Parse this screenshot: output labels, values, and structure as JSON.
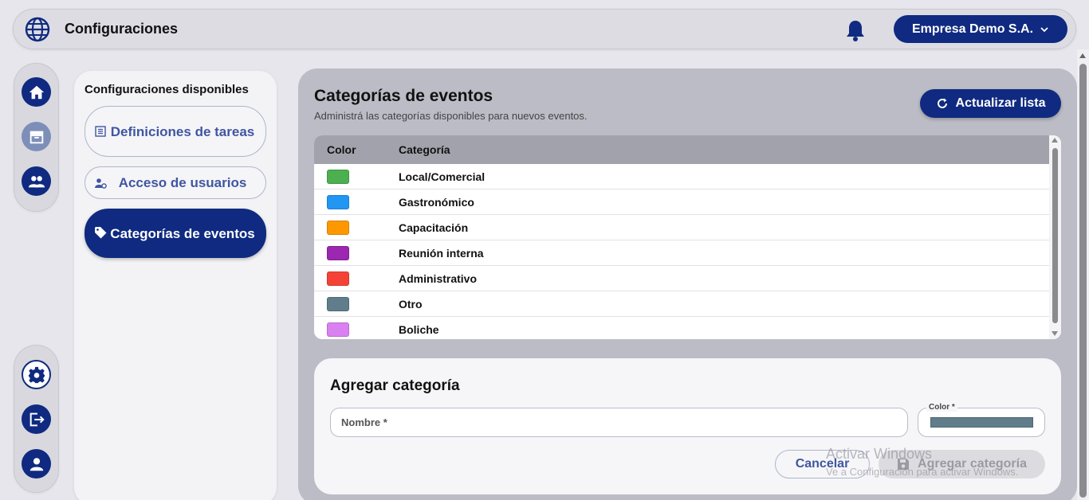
{
  "header": {
    "title": "Configuraciones",
    "company": "Empresa Demo S.A."
  },
  "rail": {
    "top": [
      {
        "icon": "home-icon"
      },
      {
        "icon": "archive-icon"
      },
      {
        "icon": "users-icon"
      }
    ],
    "bottom": [
      {
        "icon": "gear-icon"
      },
      {
        "icon": "logout-icon"
      },
      {
        "icon": "account-icon"
      }
    ]
  },
  "sidebar": {
    "title": "Configuraciones disponibles",
    "items": [
      {
        "label": "Definiciones de tareas",
        "icon": "list-icon",
        "active": false
      },
      {
        "label": "Acceso de usuarios",
        "icon": "user-gear-icon",
        "active": false
      },
      {
        "label": "Categorías de eventos",
        "icon": "tag-icon",
        "active": true
      }
    ]
  },
  "main": {
    "title": "Categorías de eventos",
    "subtitle": "Administrá las categorías disponibles para nuevos eventos.",
    "refresh_label": "Actualizar lista",
    "table": {
      "headers": {
        "color": "Color",
        "category": "Categoría"
      },
      "rows": [
        {
          "color": "#4caf50",
          "name": "Local/Comercial"
        },
        {
          "color": "#2196f3",
          "name": "Gastronómico"
        },
        {
          "color": "#ff9800",
          "name": "Capacitación"
        },
        {
          "color": "#9c27b0",
          "name": "Reunión interna"
        },
        {
          "color": "#f44336",
          "name": "Administrativo"
        },
        {
          "color": "#607d8b",
          "name": "Otro"
        },
        {
          "color": "#da80f0",
          "name": "Boliche"
        }
      ]
    }
  },
  "add_form": {
    "title": "Agregar categoría",
    "name_label": "Nombre *",
    "color_label": "Color *",
    "color_value": "#607d8b",
    "cancel_label": "Cancelar",
    "submit_label": "Agregar categoría"
  },
  "watermark": {
    "line1": "Activar Windows",
    "line2": "Ve a Configuración para activar Windows."
  }
}
